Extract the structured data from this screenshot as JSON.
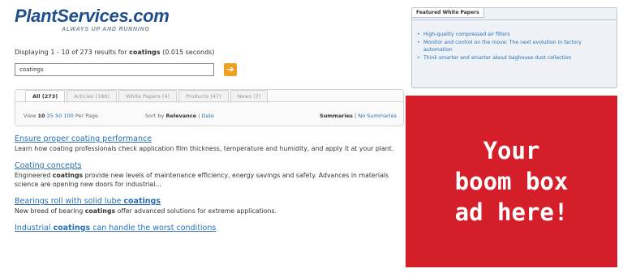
{
  "logo": {
    "title": "PlantServices.com",
    "tagline": "ALWAYS UP AND RUNNING"
  },
  "search": {
    "summary_prefix": "Displaying 1 - 10 of 273 results for ",
    "summary_query": "coatings",
    "summary_suffix": " (0.015 seconds)",
    "query": "coatings",
    "button_glyph": "➔"
  },
  "tabs": [
    {
      "label": "All (273)",
      "active": true
    },
    {
      "label": "Articles (186)",
      "active": false
    },
    {
      "label": "White Papers (4)",
      "active": false
    },
    {
      "label": "Products (47)",
      "active": false
    },
    {
      "label": "News (7)",
      "active": false
    }
  ],
  "view_bar": {
    "per_page_prefix": "View",
    "per_page_options": [
      "10",
      "25",
      "50",
      "100"
    ],
    "per_page_suffix": "Per Page",
    "sort_prefix": "Sort by",
    "sort_active": "Relevance",
    "sort_sep": "|",
    "sort_other": "Date",
    "summaries_on": "Summaries",
    "summaries_sep": "|",
    "summaries_off": "No Summaries"
  },
  "results": [
    {
      "title_parts": [
        {
          "t": "Ensure proper coating performance",
          "kw": false
        }
      ],
      "desc_parts": [
        {
          "t": "Learn how coating professionals check application film thickness, temperature and humidity, and apply it at your plant.",
          "kw": false
        }
      ]
    },
    {
      "title_parts": [
        {
          "t": "Coating concepts",
          "kw": false
        }
      ],
      "desc_parts": [
        {
          "t": "Engineered ",
          "kw": false
        },
        {
          "t": "coatings",
          "kw": true
        },
        {
          "t": " provide new levels of maintenance efficiency, energy savings and safety. Advances in materials science are opening new doors for industrial...",
          "kw": false
        }
      ]
    },
    {
      "title_parts": [
        {
          "t": "Bearings roll with solid lube ",
          "kw": false
        },
        {
          "t": "coatings",
          "kw": true
        }
      ],
      "desc_parts": [
        {
          "t": "New breed of bearing ",
          "kw": false
        },
        {
          "t": "coatings",
          "kw": true
        },
        {
          "t": " offer advanced solutions for extreme applications.",
          "kw": false
        }
      ]
    },
    {
      "title_parts": [
        {
          "t": "Industrial ",
          "kw": false
        },
        {
          "t": "coatings",
          "kw": true
        },
        {
          "t": " can handle the worst conditions",
          "kw": false
        }
      ],
      "desc_parts": []
    }
  ],
  "featured": {
    "heading": "Featured White Papers",
    "items": [
      "High-quality compressed air filters",
      "Monitor and control on the move: The next evolution in factory automation",
      "Think smarter and smarter about baghouse dust collection"
    ]
  },
  "ad": {
    "lines": [
      "Your",
      "boom box",
      "ad here!"
    ]
  },
  "colors": {
    "brand_blue": "#1f4e8c",
    "link": "#2a6fb5",
    "ad_red": "#d41f2b",
    "search_button": "#f0a020"
  }
}
